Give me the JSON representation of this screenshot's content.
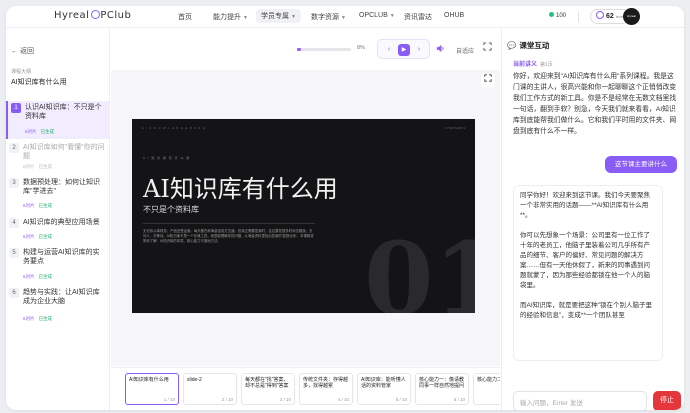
{
  "nav": {
    "logo": "Hyreal",
    "logo_suffix": "PClub",
    "items": [
      {
        "label": "首页",
        "has_caret": false
      },
      {
        "label": "能力提升",
        "has_caret": true
      },
      {
        "label": "学员专属",
        "has_caret": true,
        "active": true
      },
      {
        "label": "数字资源",
        "has_caret": true
      },
      {
        "label": "OPCLUB",
        "has_caret": true
      },
      {
        "label": "资讯雷达",
        "has_caret": false
      },
      {
        "label": "OHUB",
        "has_caret": false
      }
    ],
    "credits": "100",
    "level": "62",
    "level_sub": "level",
    "avatar_text": "Hyreal OPClub"
  },
  "sidebar": {
    "back_label": "返回",
    "outline_label": "课程大纲",
    "course_title": "AI知识库有什么用",
    "chapters": [
      {
        "num": "1",
        "title": "认识AI知识库：不只是个资料库",
        "meta": "6对片",
        "status": "已生成",
        "state": "active"
      },
      {
        "num": "2",
        "title": "AI知识库如何\"看懂\"你的问题",
        "meta": "6对片",
        "status": "已生成",
        "state": "dim"
      },
      {
        "num": "3",
        "title": "数据预处理：如何让知识库\"学进去\"",
        "meta": "6对片",
        "status": "已生成",
        "state": "normal"
      },
      {
        "num": "4",
        "title": "AI知识库的典型应用场景",
        "meta": "6对片",
        "status": "已生成",
        "state": "normal"
      },
      {
        "num": "5",
        "title": "构建与运营AI知识库的实务要点",
        "meta": "6对片",
        "status": "已生成",
        "state": "normal"
      },
      {
        "num": "6",
        "title": "趋势与实践：让AI知识库成为企业大脑",
        "meta": "6对片",
        "status": "已生成",
        "state": "normal"
      }
    ]
  },
  "toolbar": {
    "progress": 0.08,
    "progress_label": "8%",
    "prev_icon": "‹",
    "play_icon": "▶",
    "next_icon": "›",
    "volume_icon": "🔈",
    "adapt_label": "自适应",
    "fullscreen_icon": "⛶"
  },
  "slide": {
    "topline_left": "A I   K N O W L E D G E   B A S E",
    "topline_right": "C H A P T E R  0 1",
    "small_label": "A I   知 识 库 有 什 么 用",
    "title": "AI知识库有什么用",
    "subtitle": "不只是个资料库",
    "paragraph": "无论你从事财务、产品还是运营，每天都在和海量信息打交道。但真正需要答案时，往往要花很多时间去翻找、去问人、去等待。AI知识库不是一个存储工具，而是能理解你的问题、从海量资料里找出答案的'智慧伙伴'。本课程将带你了解：AI知识库的本质、核心能力与落地方法。",
    "watermark": "01"
  },
  "thumbs": [
    {
      "title": "AI知识库有什么用",
      "num": "1 / 10",
      "active": true
    },
    {
      "title": "slide-2",
      "num": "2 / 10"
    },
    {
      "title": "每天都在\"找\"答案，却不总是\"得到\"答案",
      "num": "3 / 10"
    },
    {
      "title": "传统文件夹：存得越多，找得越累",
      "num": "4 / 10"
    },
    {
      "title": "AI知识库：能听懂人话的资料管家",
      "num": "5 / 10"
    },
    {
      "title": "核心能力一：像请教同事一样自然地提问",
      "num": "6 / 10"
    },
    {
      "title": "核心能力二：",
      "num": "7 / 10"
    }
  ],
  "chat": {
    "header": "课堂互动",
    "header_icon": "chat-icon",
    "context_label": "当前讲义",
    "context_page": "第1页",
    "system_msg": "你好，欢迎来到\"AI知识库有什么用\"系列课程。我是这门课的主讲人，很高兴能和你一起聊聊这个正悄悄改变我们工作方式的新工具。你是不是经常在无数文档里找一句话，翻到手软？别急，今天我们就来看看，AI知识库到底能帮我们做什么。它和我们平时用的文件夹、网盘到底有什么不一样。",
    "user_msg": "这节课主要讲什么",
    "bot_paragraphs": [
      "同学你好！欢迎来到这节课。我们今天要聚焦一个非常实用的话题——**AI知识库有什么用**。",
      "你可以先想象一个场景：公司里有一位工作了十年的老员工，他脑子里装着公司几乎所有产品的细节、客户的偏好、常见问题的解决方案……但有一天他休假了，新来的同事遇到问题就蒙了，因为那些经验都锁在他一个人的脑袋里。",
      "而AI知识库，就是要把这种\"锁在个别人脑子里的经验和信息\"，变成**一个团队甚至"
    ],
    "input_placeholder": "输入问题，Enter 发送",
    "stop_label": "停止"
  }
}
